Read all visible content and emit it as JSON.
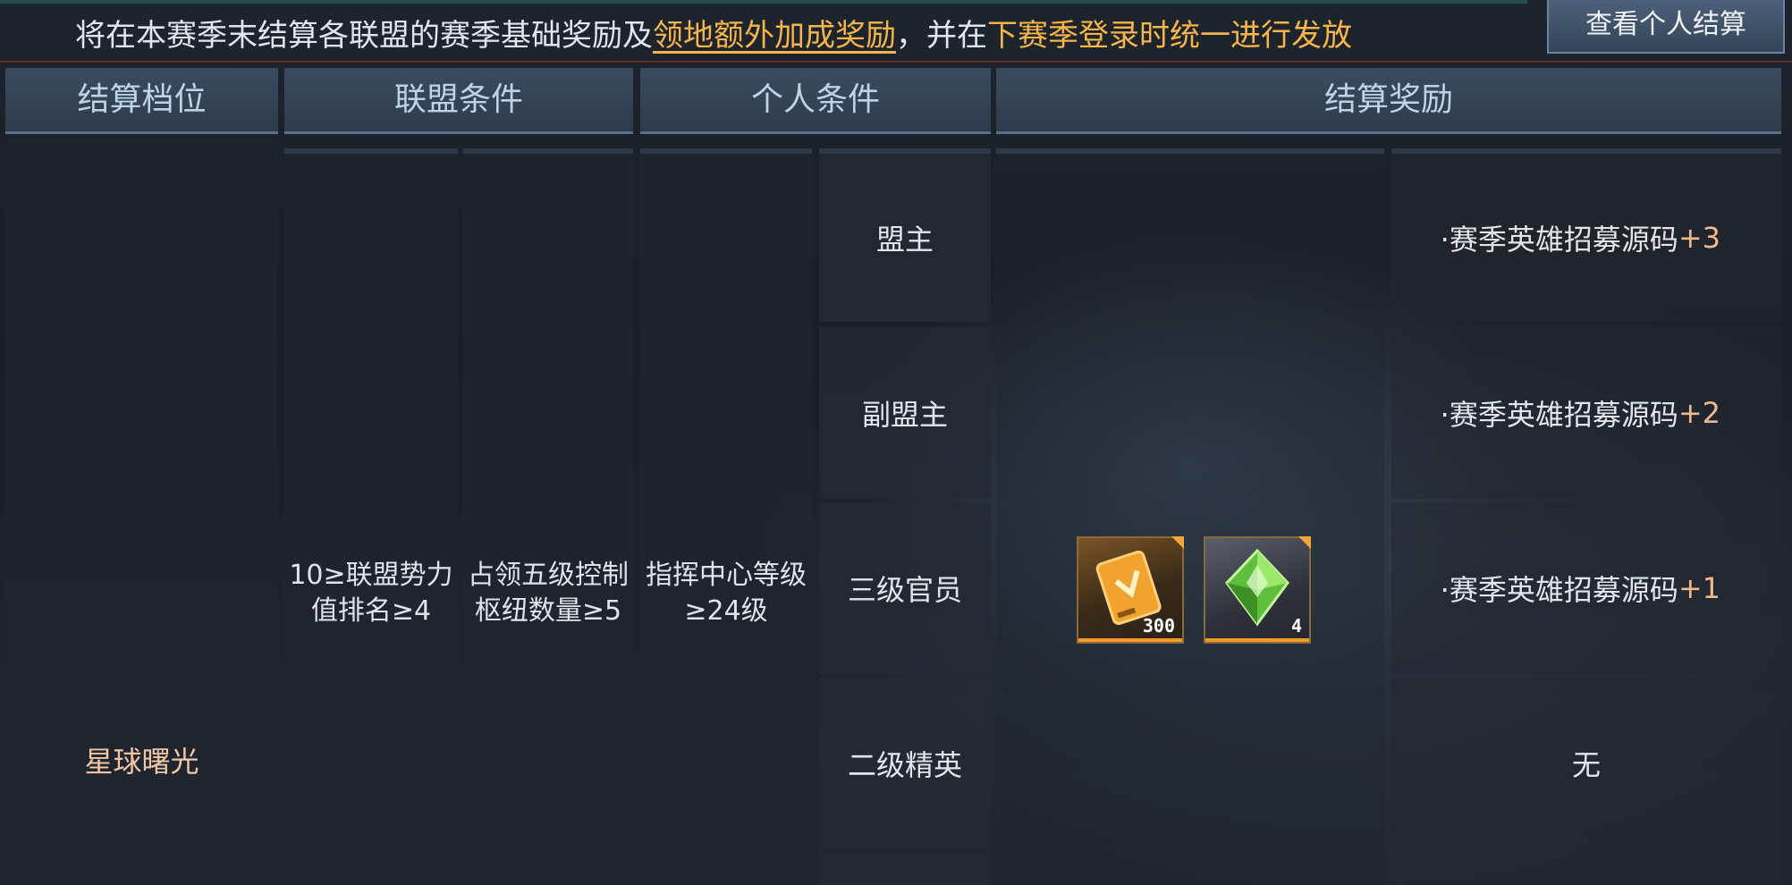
{
  "notice": {
    "part1": "将在本赛季末结算各联盟的赛季基础奖励及",
    "link": "领地额外加成奖励",
    "part2": "，并在",
    "highlight": "下赛季登录时统一进行发放"
  },
  "view_button_label": "查看个人结算",
  "headers": {
    "tier": "结算档位",
    "alliance_condition": "联盟条件",
    "personal_condition": "个人条件",
    "reward": "结算奖励"
  },
  "row": {
    "tier_name": "星球曙光",
    "alliance_condition_1": "10≥联盟势力值排名≥4",
    "alliance_condition_1_line1": "10≥联盟势力",
    "alliance_condition_1_line2": "值排名≥4",
    "alliance_condition_2_line1": "占领五级控制",
    "alliance_condition_2_line2": "枢纽数量≥5",
    "personal_condition_line1": "指挥中心等级",
    "personal_condition_line2": "≥24级"
  },
  "roles": [
    {
      "name": "盟主",
      "reward_text": "·赛季英雄招募源码",
      "reward_plus": "+3"
    },
    {
      "name": "副盟主",
      "reward_text": "·赛季英雄招募源码",
      "reward_plus": "+2"
    },
    {
      "name": "三级官员",
      "reward_text": "·赛季英雄招募源码",
      "reward_plus": "+1"
    },
    {
      "name": "二级精英",
      "reward_text": "无",
      "reward_plus": ""
    }
  ],
  "items": [
    {
      "icon": "card-chip-icon",
      "count": "300",
      "color": "#f0a030"
    },
    {
      "icon": "green-crystal-icon",
      "count": "4",
      "color": "#7bd24a"
    }
  ]
}
